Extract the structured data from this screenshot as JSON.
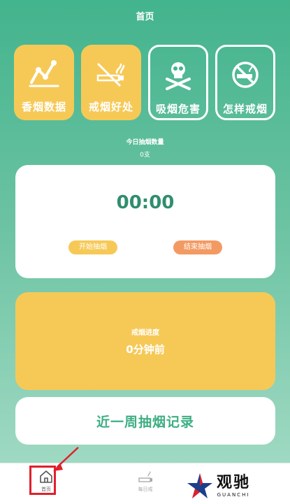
{
  "header": {
    "title": "首页"
  },
  "tiles": [
    {
      "label": "香烟数据",
      "icon": "chart-line-icon",
      "style": "filled"
    },
    {
      "label": "戒烟好处",
      "icon": "no-smoking-icon",
      "style": "filled"
    },
    {
      "label": "吸烟危害",
      "icon": "skull-crossbones-icon",
      "style": "outlined"
    },
    {
      "label": "怎样戒烟",
      "icon": "no-smoking-circle-icon",
      "style": "outlined"
    }
  ],
  "today": {
    "label": "今日抽烟数量",
    "count": "0支"
  },
  "timer": {
    "value": "00:00",
    "start_label": "开始抽烟",
    "end_label": "结束抽烟"
  },
  "progress": {
    "label": "戒烟进度",
    "value": "0分钟前"
  },
  "record": {
    "label": "近一周抽烟记录"
  },
  "tabbar": [
    {
      "label": "首页",
      "icon": "home-icon",
      "active": true
    },
    {
      "label": "每日戒",
      "icon": "cigarette-icon",
      "active": false
    }
  ],
  "watermark": {
    "cn": "观驰",
    "en": "GUANCHI"
  },
  "colors": {
    "accent_green": "#43b48d",
    "yellow": "#f6c957",
    "orange": "#f39a63",
    "timer_text": "#2f8e6d",
    "highlight_red": "#e0202c"
  }
}
